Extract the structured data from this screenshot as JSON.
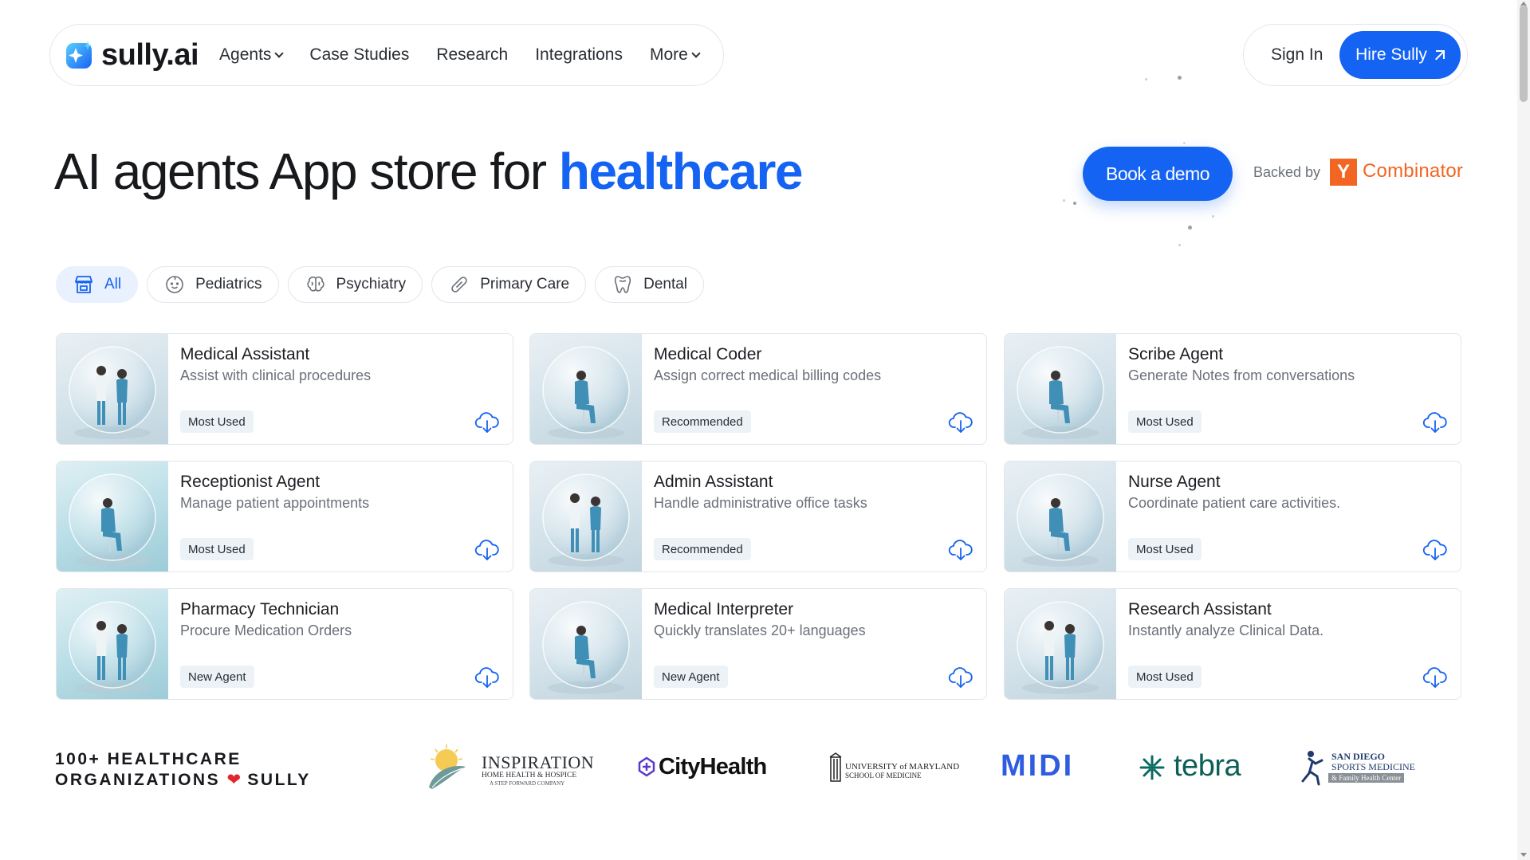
{
  "brand": {
    "name": "sully.ai"
  },
  "nav": {
    "items": [
      {
        "label": "Agents",
        "has_dropdown": true
      },
      {
        "label": "Case Studies",
        "has_dropdown": false
      },
      {
        "label": "Research",
        "has_dropdown": false
      },
      {
        "label": "Integrations",
        "has_dropdown": false
      },
      {
        "label": "More",
        "has_dropdown": true
      }
    ],
    "sign_in": "Sign In",
    "hire": "Hire Sully"
  },
  "hero": {
    "title_prefix": "AI agents App store for ",
    "title_accent": "healthcare",
    "cta": "Book a demo",
    "backed_by": "Backed by",
    "yc_letter": "Y",
    "yc_name": "Combinator"
  },
  "filters": [
    {
      "label": "All",
      "icon": "store-icon",
      "active": true
    },
    {
      "label": "Pediatrics",
      "icon": "baby-face-icon",
      "active": false
    },
    {
      "label": "Psychiatry",
      "icon": "brain-icon",
      "active": false
    },
    {
      "label": "Primary Care",
      "icon": "pill-icon",
      "active": false
    },
    {
      "label": "Dental",
      "icon": "tooth-icon",
      "active": false
    }
  ],
  "agents": [
    {
      "title": "Medical Assistant",
      "desc": "Assist with clinical procedures",
      "badge": "Most Used"
    },
    {
      "title": "Medical Coder",
      "desc": "Assign correct medical billing codes",
      "badge": "Recommended"
    },
    {
      "title": "Scribe Agent",
      "desc": "Generate Notes from conversations",
      "badge": "Most Used"
    },
    {
      "title": "Receptionist Agent",
      "desc": "Manage patient appointments",
      "badge": "Most Used"
    },
    {
      "title": "Admin Assistant",
      "desc": "Handle administrative office tasks",
      "badge": "Recommended"
    },
    {
      "title": "Nurse Agent",
      "desc": "Coordinate patient care activities.",
      "badge": "Most Used"
    },
    {
      "title": "Pharmacy Technician",
      "desc": "Procure Medication Orders",
      "badge": "New Agent"
    },
    {
      "title": "Medical Interpreter",
      "desc": "Quickly translates 20+ languages",
      "badge": "New Agent"
    },
    {
      "title": "Research Assistant",
      "desc": "Instantly analyze Clinical Data.",
      "badge": "Most Used"
    }
  ],
  "orgs": {
    "line1": "100+ HEALTHCARE",
    "line2a": "ORGANIZATIONS",
    "line2b": "SULLY",
    "heart": "❤"
  },
  "partner_logos": {
    "inspiration": {
      "name": "INSPIRATION",
      "sub1": "HOME HEALTH & HOSPICE",
      "sub2": "A STEP FORWARD COMPANY"
    },
    "cityhealth": {
      "name": "CityHealth"
    },
    "umaryland": {
      "line1": "UNIVERSITY of MARYLAND",
      "line2": "SCHOOL OF MEDICINE"
    },
    "midi": {
      "name": "MIDI"
    },
    "tebra": {
      "name": "tebra"
    },
    "sandiego": {
      "line1": "SAN DIEGO",
      "line2": "SPORTS MEDICINE",
      "line3": "& Family Health Center"
    }
  },
  "colors": {
    "accent": "#1463f3",
    "yc": "#f26522",
    "heart": "#e0262f"
  }
}
